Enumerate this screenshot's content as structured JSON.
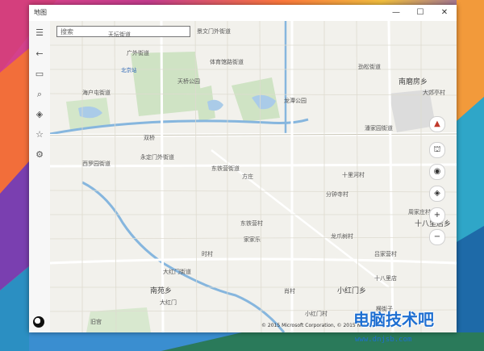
{
  "window": {
    "title": "地图",
    "controls": {
      "minimize": "—",
      "maximize": "☐",
      "close": "✕"
    }
  },
  "sidebar": {
    "items": [
      {
        "name": "menu",
        "glyph": "☰"
      },
      {
        "name": "back",
        "glyph": "←"
      },
      {
        "name": "map",
        "glyph": "▭"
      },
      {
        "name": "search",
        "glyph": "⌕"
      },
      {
        "name": "directions",
        "glyph": "◈"
      },
      {
        "name": "favorites",
        "glyph": "☆"
      },
      {
        "name": "settings",
        "glyph": "⚙"
      }
    ]
  },
  "search": {
    "placeholder": "搜索"
  },
  "map": {
    "labels": {
      "l1": "天坛街道",
      "l2": "广外街道",
      "l3": "景文门外街道",
      "l4": "北京站",
      "l5": "天桥公园",
      "l6": "体育馆路街道",
      "l7": "劲松街道",
      "l8": "南磨房乡",
      "l9": "大郊亭村",
      "l10": "潘家园街道",
      "l11": "双桥",
      "l12": "永定门外街道",
      "l13": "东铁营街道",
      "l14": "西罗园街道",
      "l15": "方庄",
      "l16": "十里河村",
      "l17": "分钟寺村",
      "l18": "周家庄村",
      "l19": "十八里店乡",
      "l20": "东铁营村",
      "l21": "龙爪树村",
      "l22": "吕家营村",
      "l23": "南苑乡",
      "l24": "十八里店",
      "l25": "小红门乡",
      "l26": "大红门街道",
      "l27": "时村",
      "l28": "肖村",
      "l29": "小红门村",
      "l30": "横街子",
      "l31": "家家乐",
      "l32": "海户屯街道",
      "l33": "大红门",
      "l34": "旧宫",
      "l35": "龙潭公园"
    },
    "copyright": "© 2015 Microsoft Corporation, © 2015 Nokia, ..."
  },
  "map_controls": {
    "compass": "▲",
    "streetside": "⛫",
    "locate": "◉",
    "layers": "◈",
    "zoom_in": "+",
    "zoom_out": "−"
  },
  "watermark": {
    "text": "电脑技术吧",
    "url": "www.dnjsb.com"
  }
}
